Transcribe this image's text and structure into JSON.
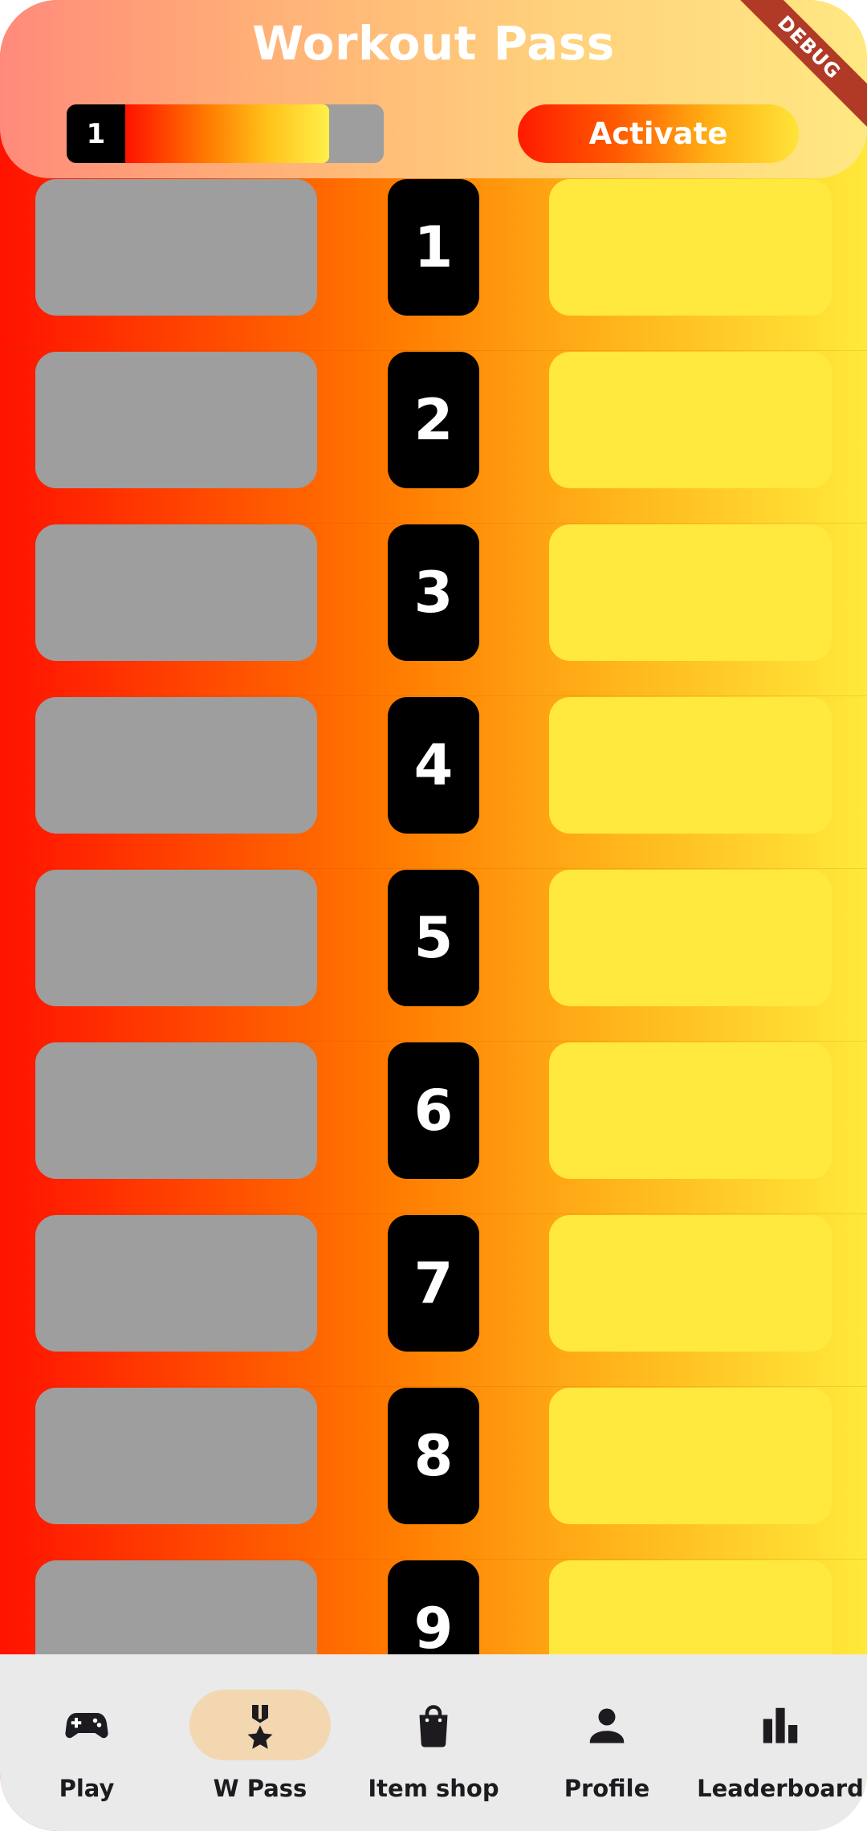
{
  "header": {
    "title": "Workout Pass",
    "level": "1",
    "progress_percent": 79,
    "activate_label": "Activate",
    "debug_label": "DEBUG"
  },
  "rows": [
    {
      "level": "1"
    },
    {
      "level": "2"
    },
    {
      "level": "3"
    },
    {
      "level": "4"
    },
    {
      "level": "5"
    },
    {
      "level": "6"
    },
    {
      "level": "7"
    },
    {
      "level": "8"
    },
    {
      "level": "9"
    }
  ],
  "nav": {
    "active": "W Pass",
    "items": [
      {
        "label": "Play",
        "icon": "gamepad-icon"
      },
      {
        "label": "W Pass",
        "icon": "medal-icon"
      },
      {
        "label": "Item shop",
        "icon": "shopping-bag-icon"
      },
      {
        "label": "Profile",
        "icon": "person-icon"
      },
      {
        "label": "Leaderboard",
        "icon": "bar-chart-icon"
      }
    ]
  },
  "colors": {
    "free_tier_box": "#9e9e9e",
    "premium_tier_box": "#ffe93f",
    "badge": "#000000",
    "nav_active_pill": "#f2d7b0",
    "nav_background": "#eaeaea"
  }
}
